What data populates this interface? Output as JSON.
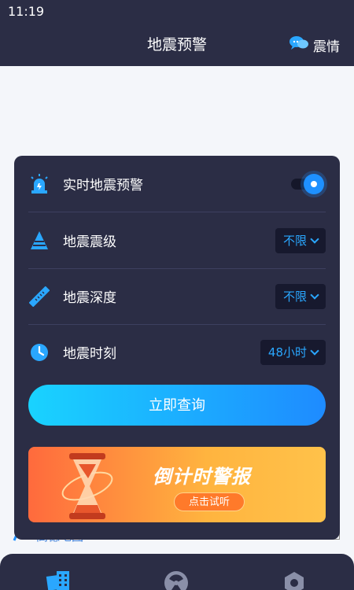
{
  "status_bar": {
    "time": "11:19"
  },
  "header": {
    "title": "地震预警",
    "action_label": "震情",
    "action_icon": "chat-bubbles-icon"
  },
  "map": {
    "watermark_text": "高德地图"
  },
  "panel": {
    "realtime": {
      "label": "实时地震预警",
      "icon": "alarm-siren-icon",
      "enabled": true
    },
    "magnitude": {
      "label": "地震震级",
      "icon": "pyramid-icon",
      "value": "不限"
    },
    "depth": {
      "label": "地震深度",
      "icon": "ruler-icon",
      "value": "不限"
    },
    "time": {
      "label": "地震时刻",
      "icon": "clock-icon",
      "value": "48小时"
    },
    "query_button": "立即查询",
    "banner": {
      "title": "倒计时警报",
      "button": "点击试听",
      "icon": "hourglass-icon"
    }
  },
  "colors": {
    "panel": "#2b2d45",
    "accent": "#1e90ff",
    "banner": "#ff7a2a"
  },
  "tabs": [
    {
      "icon": "building-icon"
    },
    {
      "icon": "radiation-icon"
    },
    {
      "icon": "settings-icon"
    }
  ]
}
